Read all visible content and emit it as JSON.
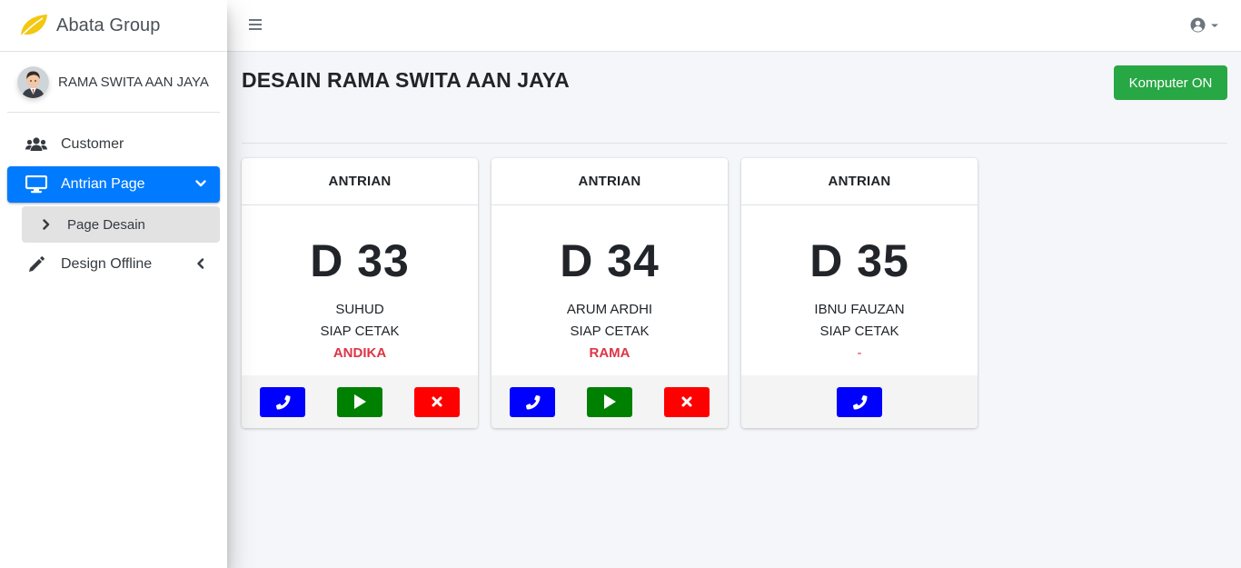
{
  "brand": {
    "name": "Abata Group"
  },
  "user": {
    "name": "RAMA SWITA AAN JAYA"
  },
  "sidebar": {
    "items": [
      {
        "label": "Customer",
        "icon": "users-icon"
      },
      {
        "label": "Antrian Page",
        "icon": "desktop-icon",
        "active": true
      },
      {
        "label": "Page Desain",
        "icon": "chevron-right-icon",
        "sub": true
      },
      {
        "label": "Design Offline",
        "icon": "pencil-icon"
      }
    ]
  },
  "header": {
    "title": "DESAIN RAMA SWITA AAN JAYA",
    "button": "Komputer ON"
  },
  "colors": {
    "primary": "#007bff",
    "success": "#28a745",
    "danger": "#dc3545",
    "call": "#0000ff",
    "play": "#008000",
    "delete": "#ff0000"
  },
  "cards": [
    {
      "header": "ANTRIAN",
      "number": "D 33",
      "name": "SUHUD",
      "status": "SIAP CETAK",
      "operator": "ANDIKA"
    },
    {
      "header": "ANTRIAN",
      "number": "D 34",
      "name": "ARUM ARDHI",
      "status": "SIAP CETAK",
      "operator": "RAMA"
    },
    {
      "header": "ANTRIAN",
      "number": "D 35",
      "name": "IBNU FAUZAN",
      "status": "SIAP CETAK",
      "operator": "-"
    }
  ]
}
